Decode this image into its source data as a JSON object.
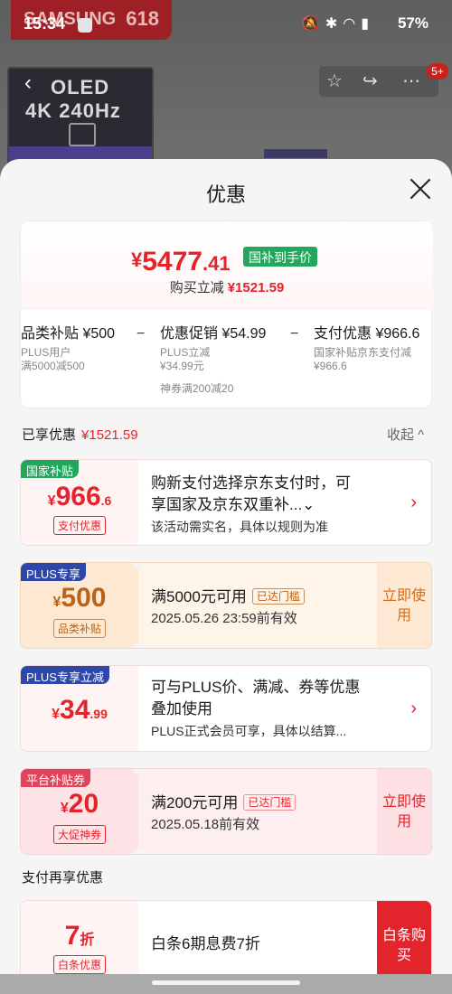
{
  "status": {
    "time": "15:34",
    "battery": "57%",
    "icons_label": "5G"
  },
  "background": {
    "brand": "SAMSUNG",
    "event": "618",
    "oled_line1": "OLED",
    "oled_line2": "4K 240Hz",
    "cart_badge": "5+"
  },
  "sheet": {
    "title": "优惠"
  },
  "summary": {
    "price_symbol": "¥",
    "price_int": "5477",
    "price_dec": ".41",
    "tag": "国补到手价",
    "reduce_label": "购买立减",
    "reduce_value": "¥1521.59",
    "columns": [
      {
        "head": "品类补贴 ¥500",
        "line1": "PLUS用户",
        "line2": "满5000减500"
      },
      {
        "head": "优惠促销 ¥54.99",
        "line1": "PLUS立减",
        "line2": "¥34.99元",
        "line3": "神券满200减20"
      },
      {
        "head": "支付优惠 ¥966.6",
        "line1": "国家补贴京东支付减",
        "line2": "¥966.6"
      }
    ]
  },
  "enjoyed": {
    "label": "已享优惠",
    "value": "¥1521.59",
    "collapse": "收起 ^"
  },
  "cards": [
    {
      "tag": "国家补贴",
      "symbol": "¥",
      "int": "966",
      "dec": ".6",
      "sub": "支付优惠",
      "line1": "购新支付选择京东支付时，可",
      "line2": "享国家及京东双重补...⌄",
      "note": "该活动需实名，具体以规则为准",
      "arrow": "›"
    },
    {
      "tag": "PLUS专享",
      "symbol": "¥",
      "int": "500",
      "dec": "",
      "sub": "品类补贴",
      "line1": "满5000元可用",
      "badge": "已达门槛",
      "note": "2025.05.26 23:59前有效",
      "use": "立即使用"
    },
    {
      "tag": "PLUS专享立减",
      "symbol": "¥",
      "int": "34",
      "dec": ".99",
      "line1": "可与PLUS价、满减、券等优惠",
      "line2": "叠加使用",
      "note": "PLUS正式会员可享，具体以结算...",
      "arrow": "›"
    },
    {
      "tag": "平台补贴券",
      "symbol": "¥",
      "int": "20",
      "dec": "",
      "sub": "大促神券",
      "line1": "满200元可用",
      "badge": "已达门槛",
      "note": "2025.05.18前有效",
      "use": "立即使用"
    }
  ],
  "pay_again": {
    "label": "支付再享优惠"
  },
  "baitiao": {
    "discount": "7",
    "discount_unit": "折",
    "sub": "白条优惠",
    "text": "白条6期息费7折",
    "button": "白条购买"
  }
}
